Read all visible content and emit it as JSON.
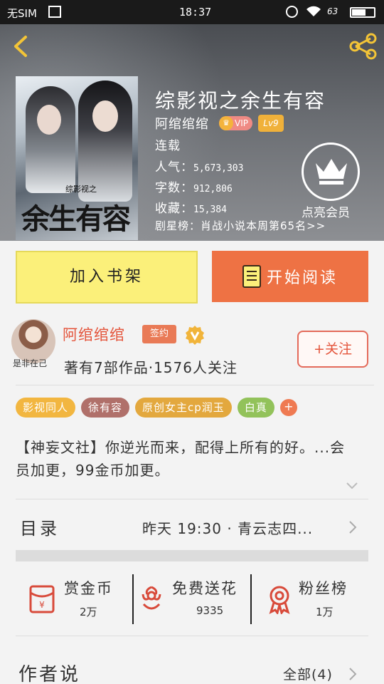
{
  "status_bar": {
    "carrier": "无SIM",
    "time": "18:37",
    "battery_pct": "63",
    "battery_level": 0.63
  },
  "book": {
    "title": "综影视之余生有容",
    "author": "阿绾绾绾",
    "vip_label": "VIP",
    "level": "Lv9",
    "status": "连载",
    "popularity_label": "人气：",
    "popularity": "5,673,303",
    "words_label": "字数：",
    "words": "912,806",
    "favorites_label": "收藏：",
    "favorites": "15,384",
    "rank": "剧星榜：肖战小说本周第65名>>",
    "cover": {
      "subtitle": "综影视之",
      "title": "余生有容"
    }
  },
  "membership": {
    "label": "点亮会员",
    "icon": "crown-icon"
  },
  "actions": {
    "add_shelf": "加入书架",
    "start_reading": "开始阅读"
  },
  "author_card": {
    "name": "阿绾绾绾",
    "avatar_caption": "是非在己",
    "signed_label": "签约",
    "stats": "著有7部作品·1576人关注",
    "follow_label": "+关注"
  },
  "tags": [
    {
      "label": "影视同人",
      "color": "#f2b640"
    },
    {
      "label": "徐有容",
      "color": "#b0706a"
    },
    {
      "label": "原创女主cp润玉",
      "color": "#e3a83e"
    },
    {
      "label": "白真",
      "color": "#92c25a"
    }
  ],
  "tags_more": "+",
  "intro": "【神妄文社】你逆光而来，配得上所有的好。...会员加更，99金币加更。",
  "toc": {
    "label": "目录",
    "latest": "昨天 19:30 · 青云志四..."
  },
  "stats": {
    "reward": {
      "label": "赏金币",
      "value": "2万",
      "icon": "red-envelope-icon"
    },
    "flower": {
      "label": "免费送花",
      "value": "9335",
      "icon": "flower-icon"
    },
    "fans": {
      "label": "粉丝榜",
      "value": "1万",
      "icon": "medal-icon"
    }
  },
  "author_says": {
    "label": "作者说",
    "all": "全部(4)"
  },
  "colors": {
    "accent_orange": "#ee7244",
    "shelf_yellow": "#fbf07a",
    "author_red": "#e4553c"
  }
}
